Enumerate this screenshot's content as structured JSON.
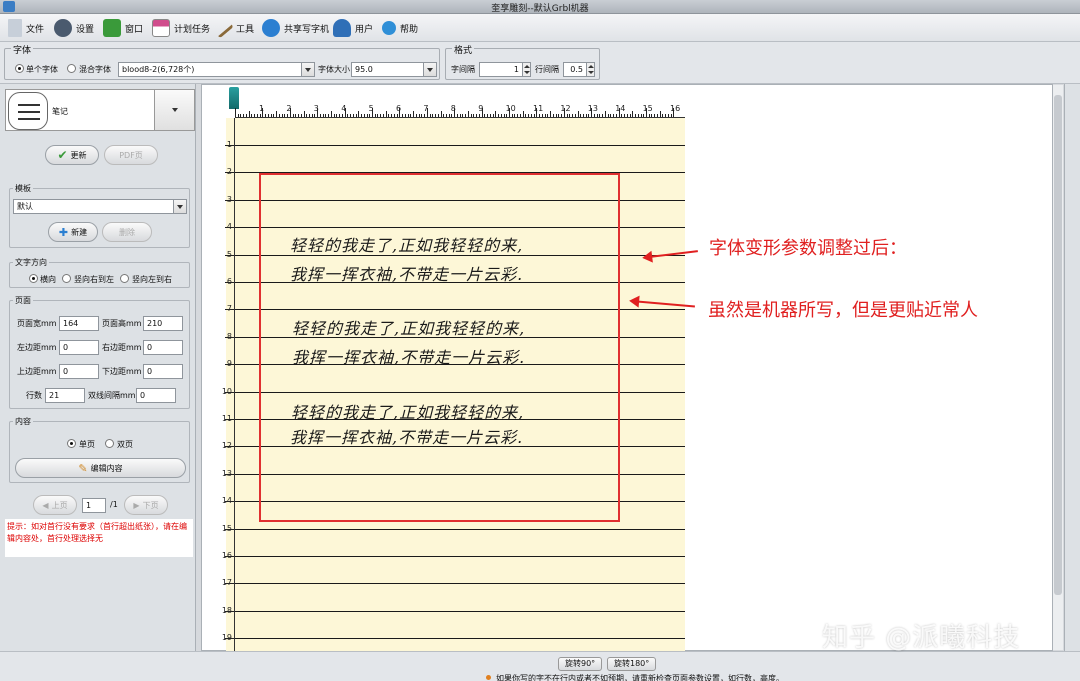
{
  "window": {
    "title": "奎享雕刻--默认Grbl机器"
  },
  "menu": [
    {
      "label": "文件",
      "icon": "file-icon",
      "color": "#6b7c93"
    },
    {
      "label": "设置",
      "icon": "gear-icon",
      "color": "#4a5a6e"
    },
    {
      "label": "窗口",
      "icon": "window-icon",
      "color": "#3a9a3a"
    },
    {
      "label": "计划任务",
      "icon": "schedule-icon",
      "color": "#d04c8c"
    },
    {
      "label": "工具",
      "icon": "hammer-icon",
      "color": "#8a6a3a"
    },
    {
      "label": "共享写字机",
      "icon": "share-icon",
      "color": "#2b7fd1"
    },
    {
      "label": "用户",
      "icon": "user-icon",
      "color": "#2f6fb7"
    },
    {
      "label": "帮助",
      "icon": "help-icon",
      "color": "#2f8fd7"
    }
  ],
  "font": {
    "group_title": "字体",
    "single_font": "单个字体",
    "mixed_font": "混合字体",
    "font_name": "blood8-2(6,728个)",
    "size_label": "字体大小",
    "size_value": "95.0"
  },
  "format": {
    "group_title": "格式",
    "char_spacing_label": "字间隔",
    "char_spacing_value": "1",
    "line_spacing_label": "行间隔",
    "line_spacing_value": "0.5"
  },
  "left": {
    "mode_label": "笔记",
    "update_btn": "更新",
    "pdf_btn": "PDF页",
    "template": {
      "title": "模板",
      "value": "默认",
      "new_btn": "新建",
      "delete_btn": "删除"
    },
    "direction": {
      "title": "文字方向",
      "opt1": "横向",
      "opt2": "竖向右到左",
      "opt3": "竖向左到右"
    },
    "page": {
      "title": "页面",
      "width_label": "页面宽mm",
      "width_value": "164",
      "height_label": "页面高mm",
      "height_value": "210",
      "left_label": "左边距mm",
      "left_value": "0",
      "right_label": "右边距mm",
      "right_value": "0",
      "top_label": "上边距mm",
      "top_value": "0",
      "bottom_label": "下边距mm",
      "bottom_value": "0",
      "rows_label": "行数",
      "rows_value": "21",
      "double_label": "双线间隔mm",
      "double_value": "0"
    },
    "content": {
      "title": "内容",
      "single": "单页",
      "double": "双页",
      "edit_btn": "编辑内容"
    },
    "pager": {
      "prev": "上页",
      "current": "1",
      "total": "/1",
      "next": "下页"
    },
    "hint": "提示：如对首行没有要求（首行超出纸张），请在编辑内容处，首行处理选择无"
  },
  "ruler": {
    "h": [
      "1",
      "2",
      "3",
      "4",
      "5",
      "6",
      "7",
      "8",
      "9",
      "10",
      "11",
      "12",
      "13",
      "14",
      "15",
      "16"
    ],
    "v": [
      "1",
      "2",
      "3",
      "4",
      "5",
      "6",
      "7",
      "8",
      "9",
      "10",
      "11",
      "12",
      "13",
      "14",
      "15",
      "16",
      "17",
      "18",
      "19"
    ]
  },
  "handwriting": [
    "轻轻的我走了,正如我轻轻的来,",
    "我挥一挥衣袖,不带走一片云彩.",
    "轻轻的我走了,正如我轻轻的来,",
    "我挥一挥衣袖,不带走一片云彩.",
    "轻轻的我走了,正如我轻轻的来,",
    "我挥一挥衣袖,不带走一片云彩."
  ],
  "annotations": {
    "a1": "字体变形参数调整过后：",
    "a2": "虽然是机器所写，但是更贴近常人"
  },
  "bottom": {
    "rotate90": "旋转90°",
    "rotate180": "旋转180°",
    "note": "如果你写的字不在行内或者不如预期，请重新检查页面参数设置，如行数，高度。"
  },
  "watermark": "知乎 @派曦科技"
}
